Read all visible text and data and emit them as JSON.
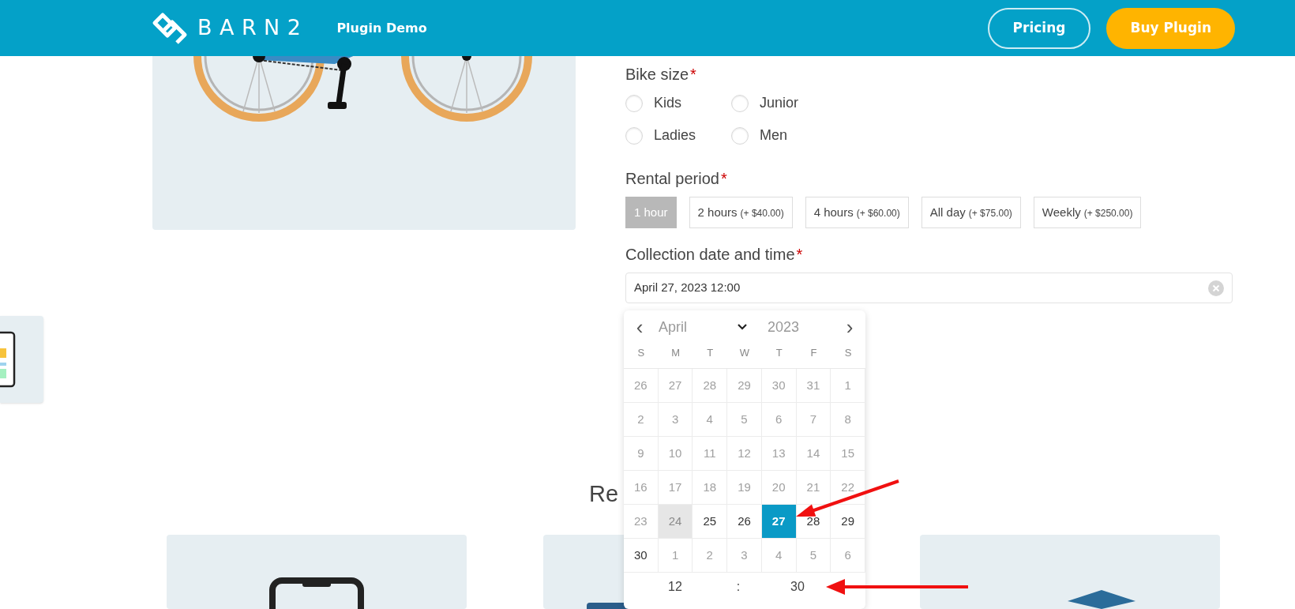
{
  "header": {
    "logo_text": "BARN2",
    "nav_link": "Plugin Demo",
    "buttons": [
      {
        "label": "Pricing",
        "kind": "outline"
      },
      {
        "label": "Buy Plugin",
        "kind": "primary"
      }
    ]
  },
  "form": {
    "bike_size": {
      "label": "Bike size",
      "required_mark": "*",
      "options": [
        {
          "label": "Kids",
          "selected": false
        },
        {
          "label": "Junior",
          "selected": false
        },
        {
          "label": "Ladies",
          "selected": false
        },
        {
          "label": "Men",
          "selected": false
        }
      ]
    },
    "rental_period": {
      "label": "Rental period",
      "required_mark": "*",
      "options": [
        {
          "label": "1 hour",
          "selected": true
        },
        {
          "label": "2 hours",
          "price": "(+ $40.00)",
          "selected": false
        },
        {
          "label": "4 hours",
          "price": "(+ $60.00)",
          "selected": false
        },
        {
          "label": "All day",
          "price": "(+ $75.00)",
          "selected": false
        },
        {
          "label": "Weekly",
          "price": "(+ $250.00)",
          "selected": false
        }
      ]
    },
    "collection": {
      "label": "Collection date and time",
      "required_mark": "*",
      "value": "April 27, 2023 12:00"
    }
  },
  "calendar": {
    "month": "April",
    "year": "2023",
    "prev": "‹",
    "next": "›",
    "weekdays": [
      "S",
      "M",
      "T",
      "W",
      "T",
      "F",
      "S"
    ],
    "weeks": [
      [
        {
          "label": "26",
          "kind": "muted",
          "selected": false
        },
        {
          "label": "27",
          "kind": "muted",
          "selected": false
        },
        {
          "label": "28",
          "kind": "muted",
          "selected": false
        },
        {
          "label": "29",
          "kind": "muted",
          "selected": false
        },
        {
          "label": "30",
          "kind": "muted",
          "selected": false
        },
        {
          "label": "31",
          "kind": "muted",
          "selected": false
        },
        {
          "label": "1",
          "kind": "muted",
          "selected": false
        }
      ],
      [
        {
          "label": "2",
          "kind": "muted",
          "selected": false
        },
        {
          "label": "3",
          "kind": "muted",
          "selected": false
        },
        {
          "label": "4",
          "kind": "muted",
          "selected": false
        },
        {
          "label": "5",
          "kind": "muted",
          "selected": false
        },
        {
          "label": "6",
          "kind": "muted",
          "selected": false
        },
        {
          "label": "7",
          "kind": "muted",
          "selected": false
        },
        {
          "label": "8",
          "kind": "muted",
          "selected": false
        }
      ],
      [
        {
          "label": "9",
          "kind": "muted",
          "selected": false
        },
        {
          "label": "10",
          "kind": "muted",
          "selected": false
        },
        {
          "label": "11",
          "kind": "muted",
          "selected": false
        },
        {
          "label": "12",
          "kind": "muted",
          "selected": false
        },
        {
          "label": "13",
          "kind": "muted",
          "selected": false
        },
        {
          "label": "14",
          "kind": "muted",
          "selected": false
        },
        {
          "label": "15",
          "kind": "muted",
          "selected": false
        }
      ],
      [
        {
          "label": "16",
          "kind": "muted",
          "selected": false
        },
        {
          "label": "17",
          "kind": "muted",
          "selected": false
        },
        {
          "label": "18",
          "kind": "muted",
          "selected": false
        },
        {
          "label": "19",
          "kind": "muted",
          "selected": false
        },
        {
          "label": "20",
          "kind": "muted",
          "selected": false
        },
        {
          "label": "21",
          "kind": "muted",
          "selected": false
        },
        {
          "label": "22",
          "kind": "muted",
          "selected": false
        }
      ],
      [
        {
          "label": "23",
          "kind": "muted",
          "selected": false
        },
        {
          "label": "24",
          "kind": "today",
          "selected": false
        },
        {
          "label": "25",
          "kind": "normal",
          "selected": false
        },
        {
          "label": "26",
          "kind": "normal",
          "selected": false
        },
        {
          "label": "27",
          "kind": "normal",
          "selected": true
        },
        {
          "label": "28",
          "kind": "normal",
          "selected": false
        },
        {
          "label": "29",
          "kind": "normal",
          "selected": false
        }
      ],
      [
        {
          "label": "30",
          "kind": "normal",
          "selected": false
        },
        {
          "label": "1",
          "kind": "muted",
          "selected": false
        },
        {
          "label": "2",
          "kind": "muted",
          "selected": false
        },
        {
          "label": "3",
          "kind": "muted",
          "selected": false
        },
        {
          "label": "4",
          "kind": "muted",
          "selected": false
        },
        {
          "label": "5",
          "kind": "muted",
          "selected": false
        },
        {
          "label": "6",
          "kind": "muted",
          "selected": false
        }
      ]
    ],
    "hour": "12",
    "separator": ":",
    "minute": "30"
  },
  "section_heading": "Re"
}
